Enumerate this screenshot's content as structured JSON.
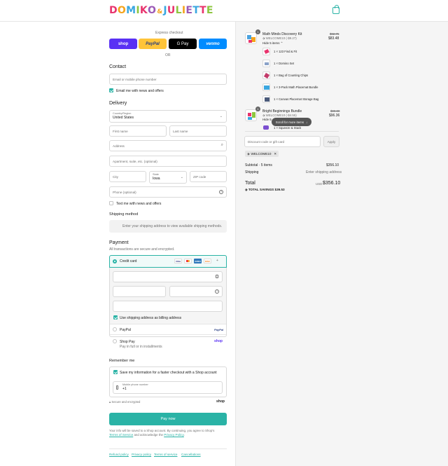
{
  "header": {
    "logo_letters": [
      "D",
      "O",
      "M",
      "I",
      "K",
      "O",
      "&",
      "J",
      "U",
      "L",
      "I",
      "E",
      "T",
      "T",
      "E"
    ],
    "logo_colors": [
      "#e8336d",
      "#f4a41c",
      "#3aa7e0",
      "#8dc63f",
      "#e8336d",
      "#9b59b6",
      "#f4a41c",
      "#3aa7e0",
      "#e8336d",
      "#8dc63f",
      "#f4a41c",
      "#9b59b6",
      "#3aa7e0",
      "#e8336d",
      "#8dc63f"
    ],
    "cart_icon": "shopping-bag-icon"
  },
  "express": {
    "title": "Express checkout",
    "buttons": [
      {
        "label": "shop",
        "color": "#5a31f4",
        "text_color": "#ffffff"
      },
      {
        "label": "PayPal",
        "color": "#ffc439",
        "text_color": "#253b80"
      },
      {
        "label": "G Pay",
        "color": "#000000",
        "text_color": "#ffffff"
      },
      {
        "label": "venmo",
        "color": "#008cff",
        "text_color": "#ffffff"
      }
    ],
    "or": "OR"
  },
  "contact": {
    "heading": "Contact",
    "email_placeholder": "Email or mobile phone number",
    "news_label": "Email me with news and offers"
  },
  "delivery": {
    "heading": "Delivery",
    "country_label": "Country/Region",
    "country_value": "United States",
    "first_name": "First name",
    "last_name": "Last name",
    "address": "Address",
    "apartment": "Apartment, suite, etc. (optional)",
    "city": "City",
    "state_label": "State",
    "state_value": "Iowa",
    "zip": "ZIP code",
    "phone": "Phone (optional)",
    "text_me": "Text me with news and offers"
  },
  "shipping": {
    "heading": "Shipping method",
    "message": "Enter your shipping address to view available shipping methods."
  },
  "payment": {
    "heading": "Payment",
    "subtitle": "All transactions are secure and encrypted.",
    "credit_card": "Credit card",
    "card_brands": [
      "VISA",
      "MC",
      "AMEX",
      "DISC"
    ],
    "more_cards": "+",
    "billing_same": "Use shipping address as billing address",
    "paypal": "PayPal",
    "paypal_logo": "PayPal",
    "shop_pay": "Shop Pay",
    "shop_pay_sub": "Pay in full or in installments",
    "shop_logo": "shop"
  },
  "remember": {
    "heading": "Remember me",
    "save_label": "Save my information for a faster checkout with a Shop account",
    "phone_label": "Mobile phone number",
    "phone_value": "+1",
    "secure": "Secure and encrypted",
    "shop_logo": "shop"
  },
  "pay_now": "Pay now",
  "legal": {
    "line1": "Your info will be saved to a Shop account. By continuing, you agree to Shop's",
    "terms": "Terms of Service",
    "and": "and acknowledge the",
    "privacy": "Privacy Policy"
  },
  "footer_links": [
    "Refund policy",
    "Privacy policy",
    "Terms of service",
    "Cancellations"
  ],
  "cart": {
    "items": [
      {
        "qty": "1",
        "name": "Math Minds Discovery Kit",
        "discount": "WELCOME10 (-$9.27)",
        "original": "$92.75",
        "price": "$83.48",
        "toggle": "Hide 5 items",
        "subitems": [
          "1 × 123 Find & Fit",
          "1 × Domino Set",
          "1 × Bag of Counting Chips",
          "1 × 3-Pack Math Placemat Bundle",
          "1 × Canvas Placemat Storage Bag"
        ]
      },
      {
        "qty": "1",
        "name": "Bright Beginnings Bundle",
        "discount": "WELCOME10 (-$4.55)",
        "original": "$99.00",
        "price": "$96.36",
        "toggle": "Hide 5",
        "subitems": [
          "1 × Squeeze & Stack"
        ]
      }
    ],
    "scroll_tip": "Scroll for more items",
    "discount_placeholder": "Discount code or gift card",
    "apply": "Apply",
    "applied_code": "WELCOME10",
    "subtotal_label": "Subtotal · 5 items",
    "subtotal_value": "$356.10",
    "shipping_label": "Shipping",
    "shipping_value": "Enter shipping address",
    "total_label": "Total",
    "currency": "USD",
    "total_value": "$356.10",
    "savings_label": "TOTAL SAVINGS",
    "savings_value": "$39.53"
  }
}
